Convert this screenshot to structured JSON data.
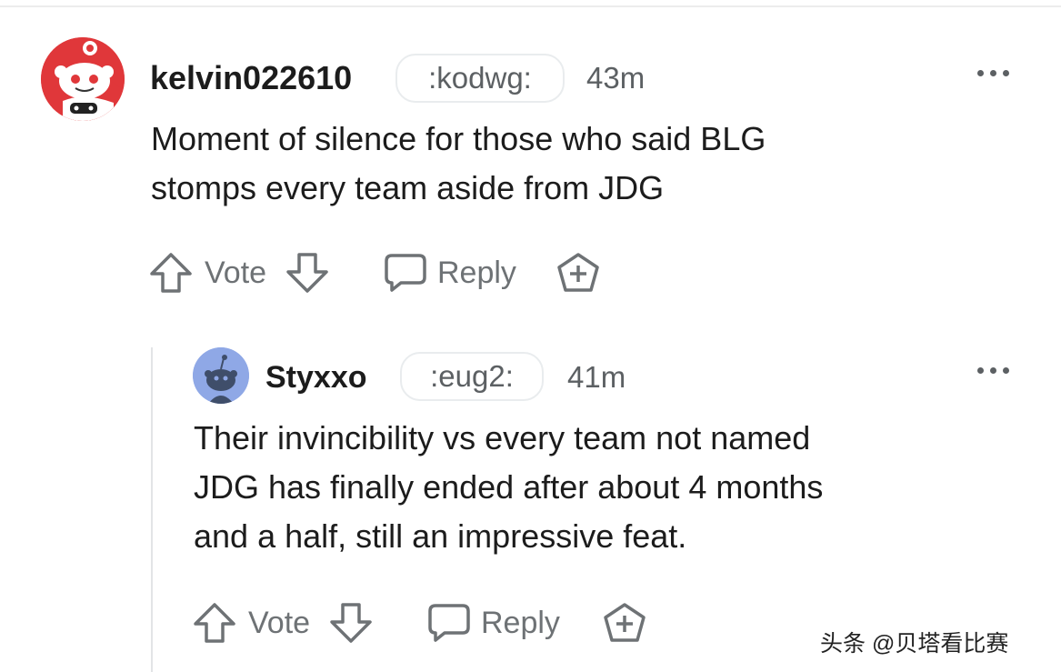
{
  "comments": [
    {
      "username": "kelvin022610",
      "flair": ":kodwg:",
      "time": "43m",
      "text_lines": [
        "Moment of silence for those who said BLG",
        "stomps every team aside from JDG"
      ],
      "vote_label": "Vote",
      "reply_label": "Reply"
    },
    {
      "username": "Styxxo",
      "flair": ":eug2:",
      "time": "41m",
      "text_lines": [
        "Their invincibility vs every team not named",
        "JDG has finally ended after about 4 months",
        "and a half, still an impressive feat."
      ],
      "vote_label": "Vote",
      "reply_label": "Reply"
    }
  ],
  "watermark": "头条 @贝塔看比赛",
  "colors": {
    "avatar1_bg": "#e0373a",
    "avatar2_bg": "#8fa8e6",
    "meta_gray": "#5c6063",
    "action_gray": "#6e7275"
  },
  "icons": [
    "snoo-avatar",
    "upvote-arrow-icon",
    "downvote-arrow-icon",
    "chat-bubble-icon",
    "award-plus-icon",
    "more-dots-icon"
  ]
}
